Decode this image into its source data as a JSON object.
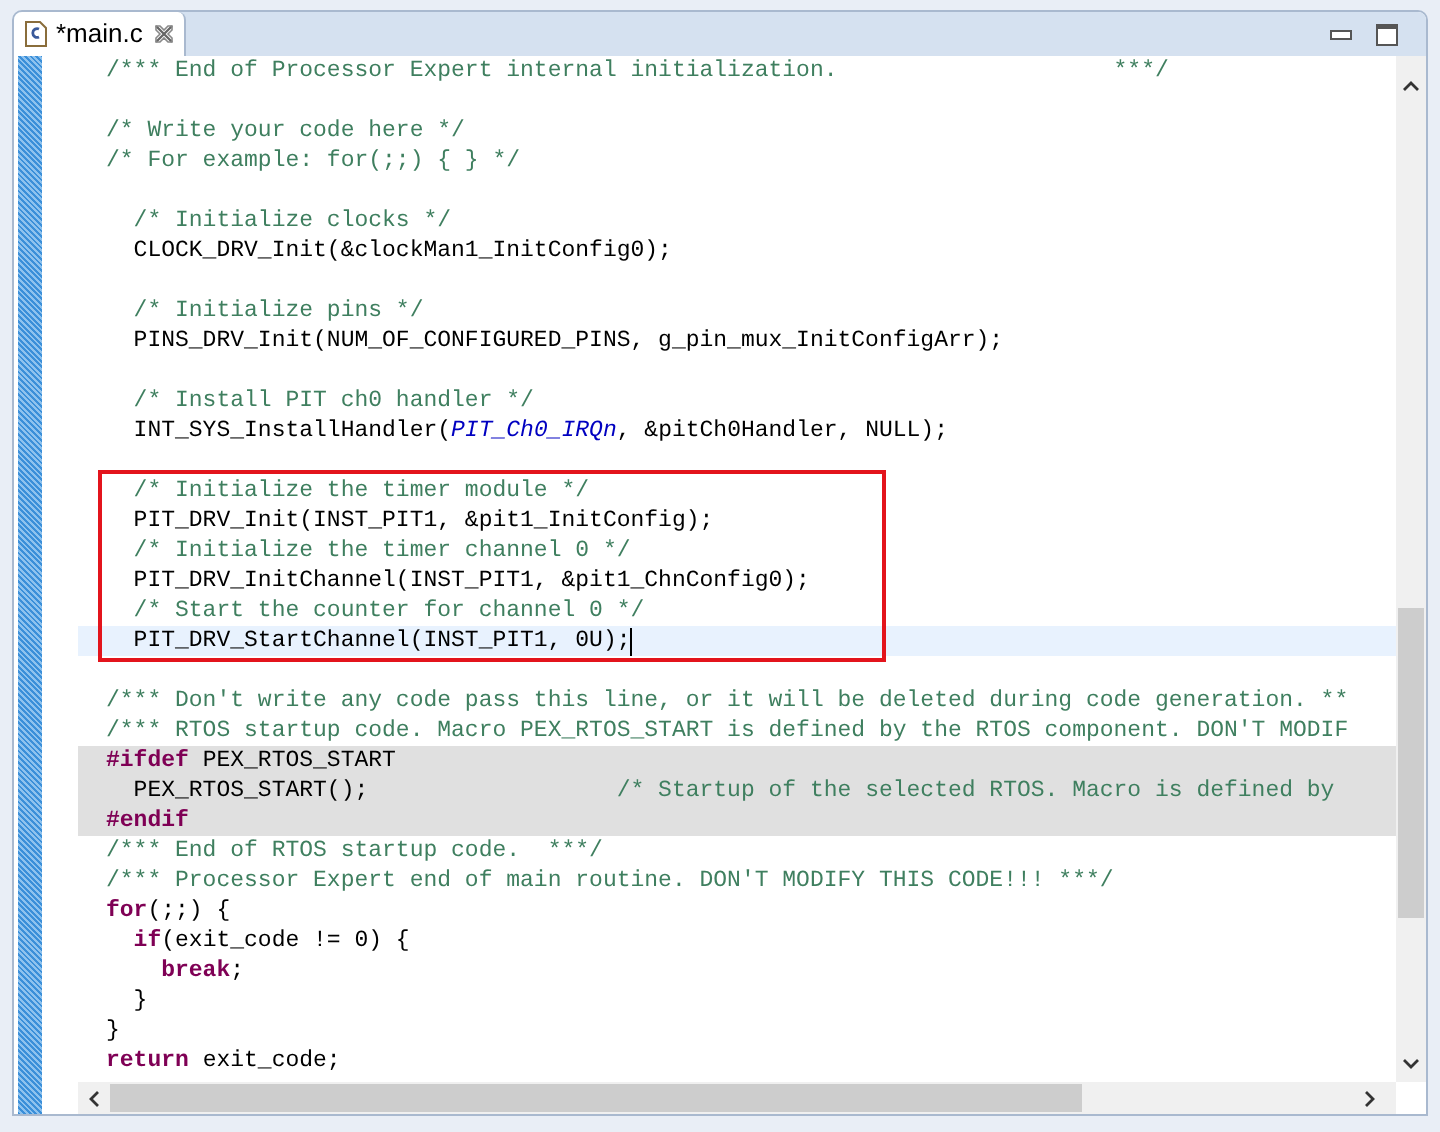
{
  "tabs": [
    {
      "label": "*main.c",
      "selected": true
    }
  ],
  "lines": [
    {
      "kind": "normal",
      "segments": [
        {
          "kind": "comment",
          "text": "/*** End of Processor Expert internal initialization.                    ***/"
        }
      ]
    },
    {
      "kind": "normal"
    },
    {
      "kind": "normal",
      "segments": [
        {
          "kind": "comment",
          "text": "/* Write your code here */"
        }
      ]
    },
    {
      "kind": "normal",
      "segments": [
        {
          "kind": "comment",
          "text": "/* For example: for(;;) { } */"
        }
      ]
    },
    {
      "kind": "normal"
    },
    {
      "kind": "normal",
      "segments": [
        {
          "kind": "comment",
          "text": "  /* Initialize clocks */"
        }
      ]
    },
    {
      "kind": "normal",
      "segments": [
        {
          "kind": "plain",
          "text": "  CLOCK_DRV_Init(&clockMan1_InitConfig0);"
        }
      ]
    },
    {
      "kind": "normal"
    },
    {
      "kind": "normal",
      "segments": [
        {
          "kind": "comment",
          "text": "  /* Initialize pins */"
        }
      ]
    },
    {
      "kind": "normal",
      "segments": [
        {
          "kind": "plain",
          "text": "  PINS_DRV_Init(NUM_OF_CONFIGURED_PINS, g_pin_mux_InitConfigArr);"
        }
      ]
    },
    {
      "kind": "normal"
    },
    {
      "kind": "normal",
      "segments": [
        {
          "kind": "comment",
          "text": "  /* Install PIT ch0 handler */"
        }
      ]
    },
    {
      "kind": "normal",
      "segments": [
        {
          "kind": "plain",
          "text": "  INT_SYS_InstallHandler("
        },
        {
          "kind": "enum",
          "text": "PIT_Ch0_IRQn"
        },
        {
          "kind": "plain",
          "text": ", &pitCh0Handler, NULL);"
        }
      ]
    },
    {
      "kind": "normal"
    },
    {
      "kind": "normal",
      "boxed": true,
      "segments": [
        {
          "kind": "comment",
          "text": "  /* Initialize the timer module */"
        }
      ]
    },
    {
      "kind": "normal",
      "boxed": true,
      "segments": [
        {
          "kind": "plain",
          "text": "  PIT_DRV_Init(INST_PIT1, &pit1_InitConfig);"
        }
      ]
    },
    {
      "kind": "normal",
      "boxed": true,
      "segments": [
        {
          "kind": "comment",
          "text": "  /* Initialize the timer channel 0 */"
        }
      ]
    },
    {
      "kind": "normal",
      "boxed": true,
      "segments": [
        {
          "kind": "plain",
          "text": "  PIT_DRV_InitChannel(INST_PIT1, &pit1_ChnConfig0);"
        }
      ]
    },
    {
      "kind": "normal",
      "boxed": true,
      "segments": [
        {
          "kind": "comment",
          "text": "  /* Start the counter for channel 0 */"
        }
      ]
    },
    {
      "kind": "current",
      "boxed": true,
      "segments": [
        {
          "kind": "plain",
          "text": "  PIT_DRV_StartChannel(INST_PIT1, 0U);"
        }
      ]
    },
    {
      "kind": "normal"
    },
    {
      "kind": "normal",
      "segments": [
        {
          "kind": "comment",
          "text": "/*** Don't write any code pass this line, or it will be deleted during code generation. **"
        }
      ]
    },
    {
      "kind": "normal",
      "segments": [
        {
          "kind": "comment",
          "text": "/*** RTOS startup code. Macro PEX_RTOS_START is defined by the RTOS component. DON'T MODIF"
        }
      ]
    },
    {
      "kind": "inactive",
      "segments": [
        {
          "kind": "keyword",
          "text": "#ifdef"
        },
        {
          "kind": "plain",
          "text": " PEX_RTOS_START"
        }
      ]
    },
    {
      "kind": "inactive",
      "segments": [
        {
          "kind": "plain",
          "text": "  PEX_RTOS_START();                  "
        },
        {
          "kind": "comment",
          "text": "/* Startup of the selected RTOS. Macro is defined by"
        }
      ]
    },
    {
      "kind": "inactive",
      "segments": [
        {
          "kind": "keyword",
          "text": "#endif"
        }
      ]
    },
    {
      "kind": "normal",
      "segments": [
        {
          "kind": "comment",
          "text": "/*** End of RTOS startup code.  ***/"
        }
      ]
    },
    {
      "kind": "normal",
      "segments": [
        {
          "kind": "comment",
          "text": "/*** Processor Expert end of main routine. DON'T MODIFY THIS CODE!!! ***/"
        }
      ]
    },
    {
      "kind": "normal",
      "segments": [
        {
          "kind": "keyword",
          "text": "for"
        },
        {
          "kind": "plain",
          "text": "(;;) {"
        }
      ]
    },
    {
      "kind": "normal",
      "segments": [
        {
          "kind": "keyword",
          "text": "  if"
        },
        {
          "kind": "plain",
          "text": "(exit_code != 0) {"
        }
      ]
    },
    {
      "kind": "normal",
      "segments": [
        {
          "kind": "keyword",
          "text": "    break"
        },
        {
          "kind": "plain",
          "text": ";"
        }
      ]
    },
    {
      "kind": "normal",
      "segments": [
        {
          "kind": "plain",
          "text": "  }"
        }
      ]
    },
    {
      "kind": "normal",
      "segments": [
        {
          "kind": "plain",
          "text": "}"
        }
      ]
    },
    {
      "kind": "normal",
      "segments": [
        {
          "kind": "keyword",
          "text": "return"
        },
        {
          "kind": "plain",
          "text": " exit_code;"
        }
      ]
    }
  ]
}
